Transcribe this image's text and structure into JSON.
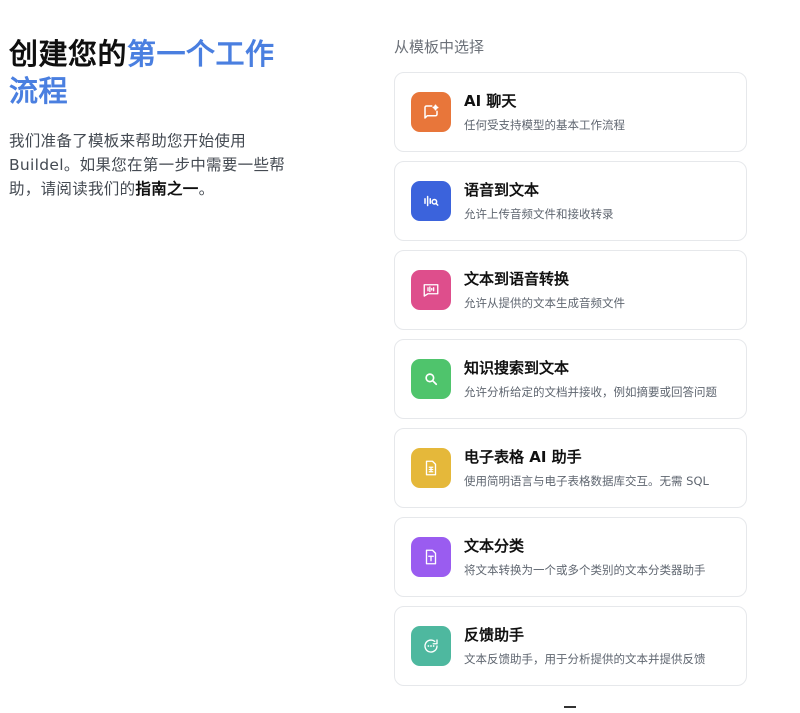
{
  "intro": {
    "title_part1": "创建您的",
    "title_part2": "第一个工作流程",
    "desc_text": "我们准备了模板来帮助您开始使用Buildel。如果您在第一步中需要一些帮助，请阅读我们的",
    "desc_link": "指南之一",
    "desc_end": "。"
  },
  "templates": {
    "label": "从模板中选择",
    "items": [
      {
        "title": "AI 聊天",
        "desc": "任何受支持模型的基本工作流程",
        "icon": "chat-spark-icon",
        "color": "#e8763a"
      },
      {
        "title": "语音到文本",
        "desc": "允许上传音频文件和接收转录",
        "icon": "audio-search-icon",
        "color": "#3b63dc"
      },
      {
        "title": "文本到语音转换",
        "desc": "允许从提供的文本生成音频文件",
        "icon": "speech-wave-icon",
        "color": "#de4e8c"
      },
      {
        "title": "知识搜索到文本",
        "desc": "允许分析给定的文档并接收，例如摘要或回答问题",
        "icon": "search-icon",
        "color": "#4fc46c"
      },
      {
        "title": "电子表格 AI 助手",
        "desc": "使用简明语言与电子表格数据库交互。无需 SQL",
        "icon": "spreadsheet-icon",
        "color": "#e5b83a"
      },
      {
        "title": "文本分类",
        "desc": "将文本转换为一个或多个类别的文本分类器助手",
        "icon": "document-text-icon",
        "color": "#9a5cf0"
      },
      {
        "title": "反馈助手",
        "desc": "文本反馈助手，用于分析提供的文本并提供反馈",
        "icon": "feedback-icon",
        "color": "#4eb89f"
      }
    ]
  }
}
